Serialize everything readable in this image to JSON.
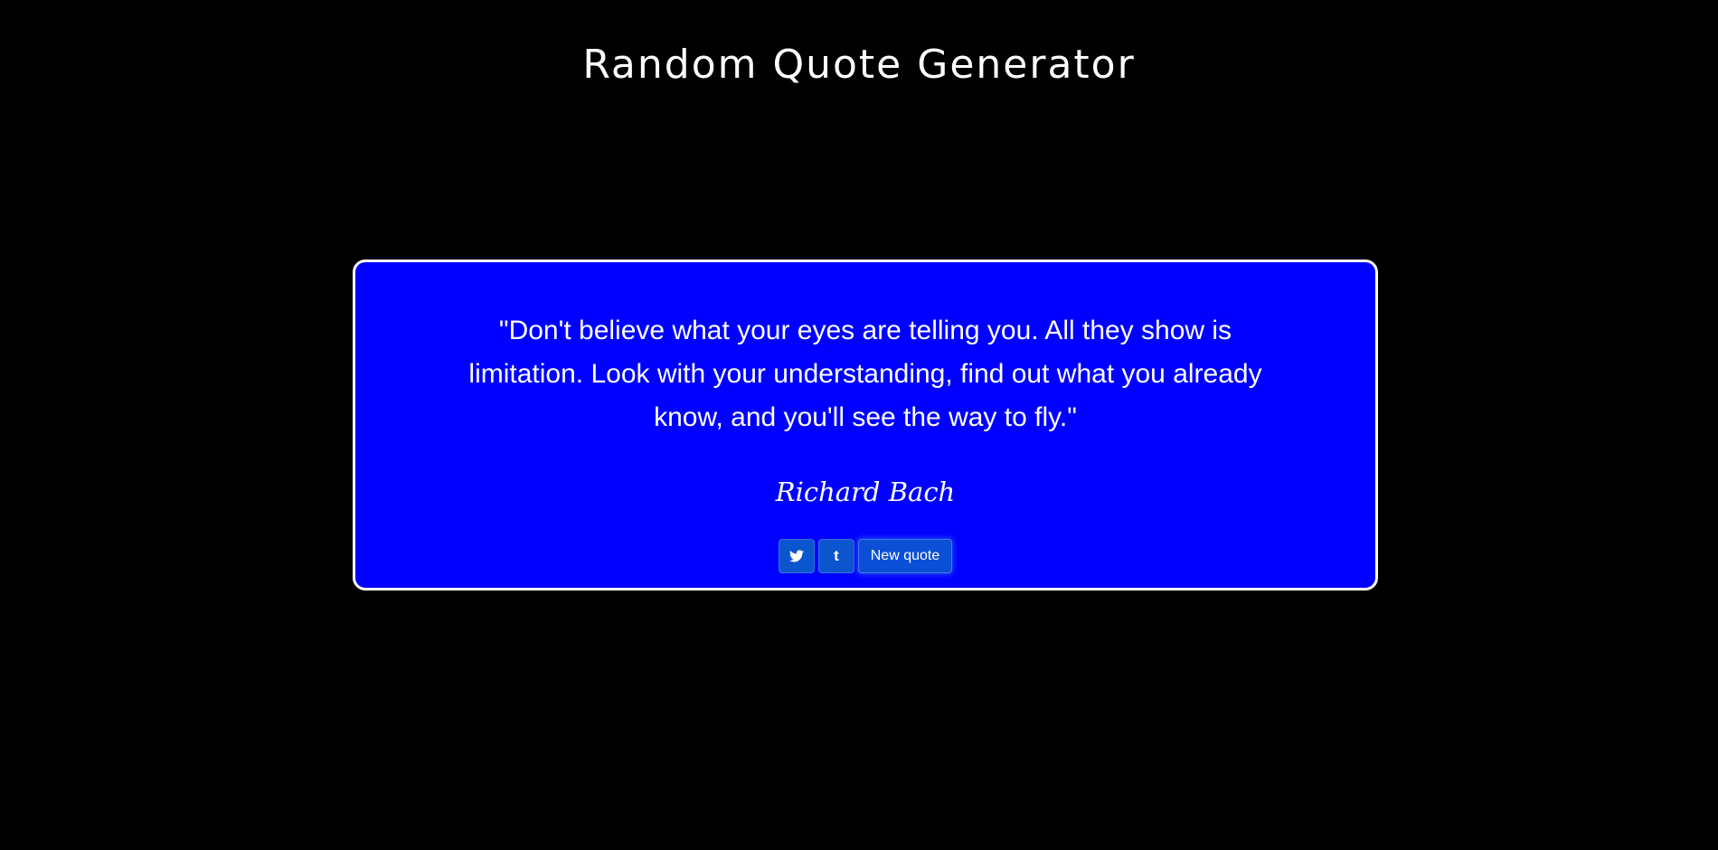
{
  "header": {
    "title": "Random Quote Generator"
  },
  "quote": {
    "text": "\"Don't believe what your eyes are telling you. All they show is limitation. Look with your understanding, find out what you already know, and you'll see the way to fly.\"",
    "author": "Richard Bach"
  },
  "actions": {
    "twitter_icon": "twitter-icon",
    "tumblr_icon": "tumblr-icon",
    "tumblr_glyph": "t",
    "new_quote_label": "New quote"
  },
  "colors": {
    "background": "#000000",
    "card": "#0000ff",
    "card_border": "#ffffff",
    "button": "#0b55cf",
    "text": "#ffffff"
  }
}
